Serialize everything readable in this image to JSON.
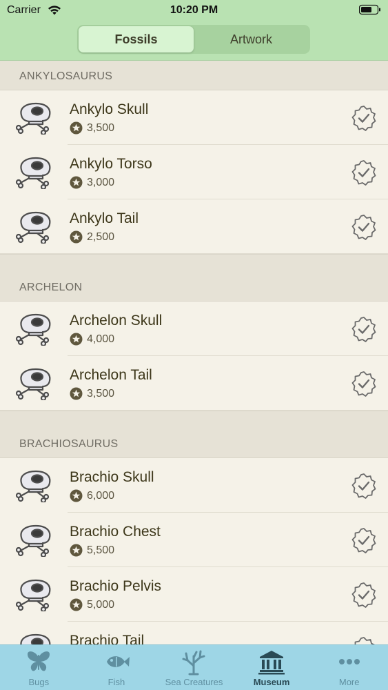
{
  "status_bar": {
    "carrier": "Carrier",
    "time": "10:20 PM"
  },
  "segments": [
    {
      "label": "Fossils",
      "active": true
    },
    {
      "label": "Artwork",
      "active": false
    }
  ],
  "sections": [
    {
      "title": "ANKYLOSAURUS",
      "items": [
        {
          "name": "Ankylo Skull",
          "price": "3,500"
        },
        {
          "name": "Ankylo Torso",
          "price": "3,000"
        },
        {
          "name": "Ankylo Tail",
          "price": "2,500"
        }
      ]
    },
    {
      "title": "ARCHELON",
      "items": [
        {
          "name": "Archelon Skull",
          "price": "4,000"
        },
        {
          "name": "Archelon Tail",
          "price": "3,500"
        }
      ]
    },
    {
      "title": "BRACHIOSAURUS",
      "items": [
        {
          "name": "Brachio Skull",
          "price": "6,000"
        },
        {
          "name": "Brachio Chest",
          "price": "5,500"
        },
        {
          "name": "Brachio Pelvis",
          "price": "5,000"
        },
        {
          "name": "Brachio Tail",
          "price": ""
        }
      ]
    }
  ],
  "tabs": [
    {
      "label": "Bugs",
      "icon": "butterfly-icon",
      "active": false
    },
    {
      "label": "Fish",
      "icon": "fish-icon",
      "active": false
    },
    {
      "label": "Sea Creatures",
      "icon": "coral-icon",
      "active": false
    },
    {
      "label": "Museum",
      "icon": "museum-icon",
      "active": true
    },
    {
      "label": "More",
      "icon": "more-icon",
      "active": false
    }
  ],
  "colors": {
    "header_bg": "#b9e2b2",
    "list_bg": "#f5f2e8",
    "section_bg": "#e6e2d6",
    "tabbar_bg": "#9ed6e6",
    "accent_text": "#3d371a"
  }
}
